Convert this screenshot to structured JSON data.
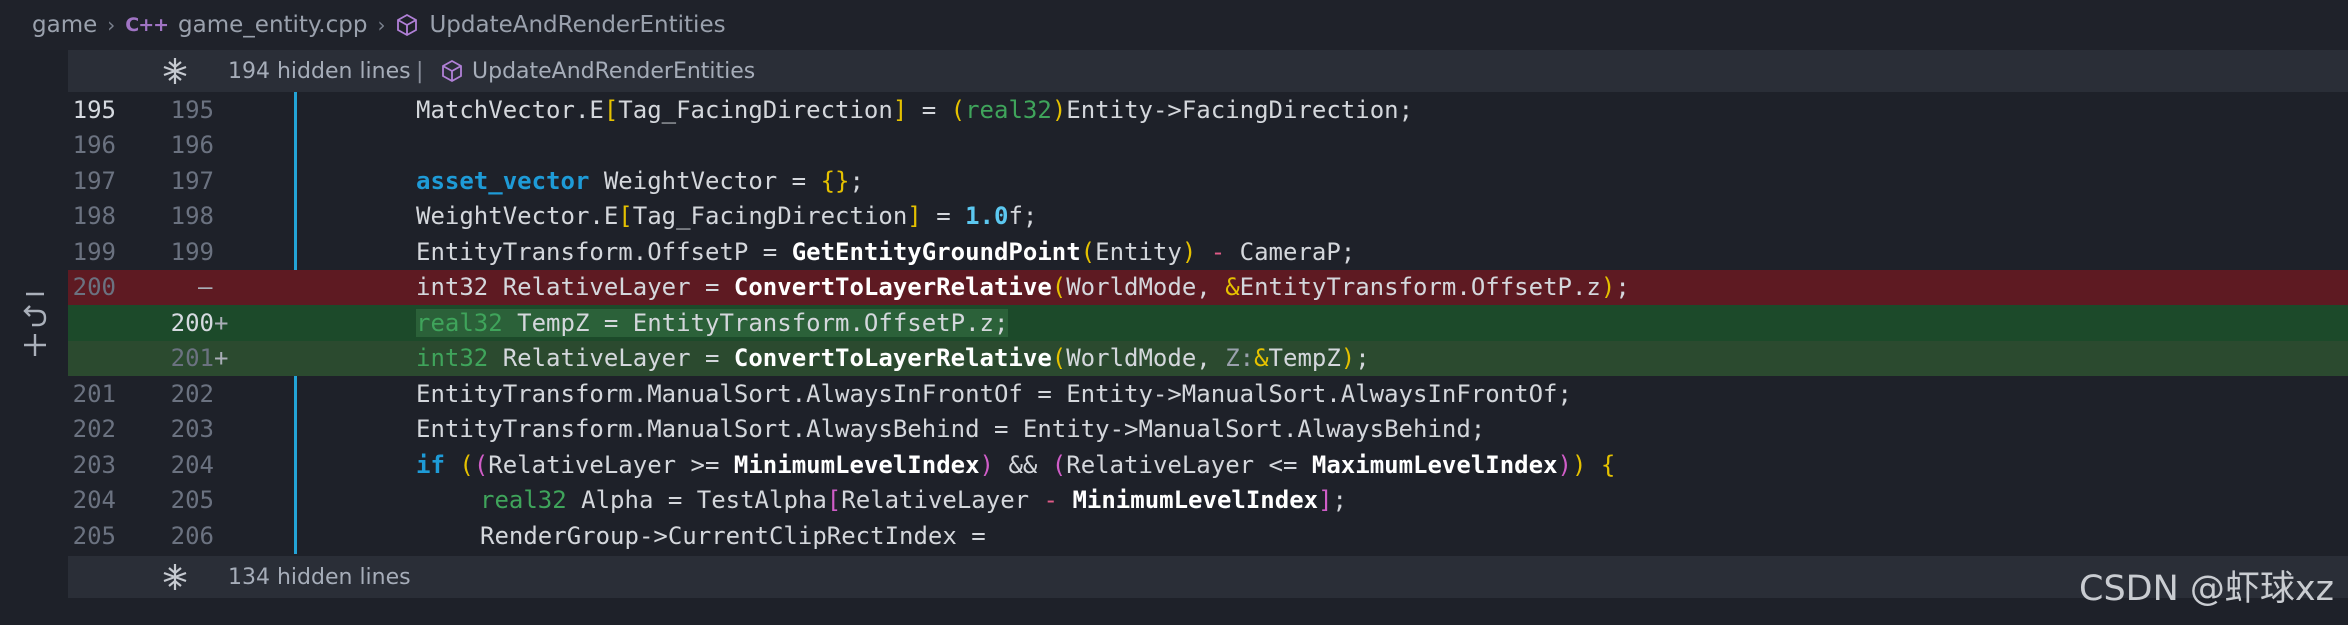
{
  "breadcrumb": {
    "folder": "game",
    "file": "game_entity.cpp",
    "file_icon": "C++",
    "symbol": "UpdateAndRenderEntities"
  },
  "folds": {
    "top": {
      "hidden": "194 hidden lines",
      "separator": "|",
      "function": "UpdateAndRenderEntities"
    },
    "bottom": {
      "hidden": "134 hidden lines"
    }
  },
  "gutter": {
    "l195": {
      "old": "195",
      "new": "195"
    },
    "l196": {
      "old": "196",
      "new": "196"
    },
    "l197": {
      "old": "197",
      "new": "197"
    },
    "l198": {
      "old": "198",
      "new": "198"
    },
    "l199": {
      "old": "199",
      "new": "199"
    },
    "l200del": {
      "old": "200",
      "marker": "—"
    },
    "l200add": {
      "new": "200",
      "marker": "+"
    },
    "l201add": {
      "new": "201",
      "marker": "+"
    },
    "l201": {
      "old": "201",
      "new": "202"
    },
    "l202": {
      "old": "202",
      "new": "203"
    },
    "l203": {
      "old": "203",
      "new": "204"
    },
    "l204": {
      "old": "204",
      "new": "205"
    },
    "l205": {
      "old": "205",
      "new": "206"
    }
  },
  "tokens": {
    "match_vector": "MatchVector.E",
    "tag_facing": "Tag_FacingDirection",
    "eq": " = ",
    "real32": "real32",
    "entity_facing": "Entity->FacingDirection;",
    "asset_vector": "asset_vector",
    "weight_vector_decl": " WeightVector = ",
    "empty_braces": "{}",
    "semi": ";",
    "weight_vector_e": "WeightVector.E",
    "one_f_num": "1.0",
    "f_suffix": "f;",
    "entity_transform_offset": "EntityTransform.OffsetP = ",
    "get_ground_point": "GetEntityGroundPoint",
    "entity": "Entity",
    "minus": " - ",
    "camera_p": "CameraP;",
    "int32": "int32",
    "relative_layer_decl": " RelativeLayer = ",
    "convert_fn": "ConvertToLayerRelative",
    "world_mode": "WorldMode, ",
    "amp": "&",
    "offset_z": "EntityTransform.OffsetP.z",
    "close_semi": ";",
    "tempz_decl": " TempZ = EntityTransform.OffsetP.z;",
    "z_label": "Z:",
    "tempz": "TempZ",
    "manual_front": "EntityTransform.ManualSort.AlwaysInFrontOf = Entity->ManualSort.AlwaysInFrontOf;",
    "manual_behind": "EntityTransform.ManualSort.AlwaysBehind = Entity->ManualSort.AlwaysBehind;",
    "if_kw": "if",
    "relative_layer": "RelativeLayer",
    "ge": " >= ",
    "min_level": "MinimumLevelIndex",
    "and": " && ",
    "le": " <= ",
    "max_level": "MaximumLevelIndex",
    "open_brace": "{",
    "alpha_decl": " Alpha = TestAlpha",
    "render_group": "RenderGroup->CurrentClipRectIndex ="
  },
  "watermark": "CSDN @虾球xz",
  "colors": {
    "deleted_bg": "#5e1a22",
    "added_bg": "#1d4a2a",
    "keyword": "#1e9bd7",
    "type": "#3fa45b",
    "bracket_gold": "#e5c100",
    "bracket_pink": "#d05dc8"
  }
}
